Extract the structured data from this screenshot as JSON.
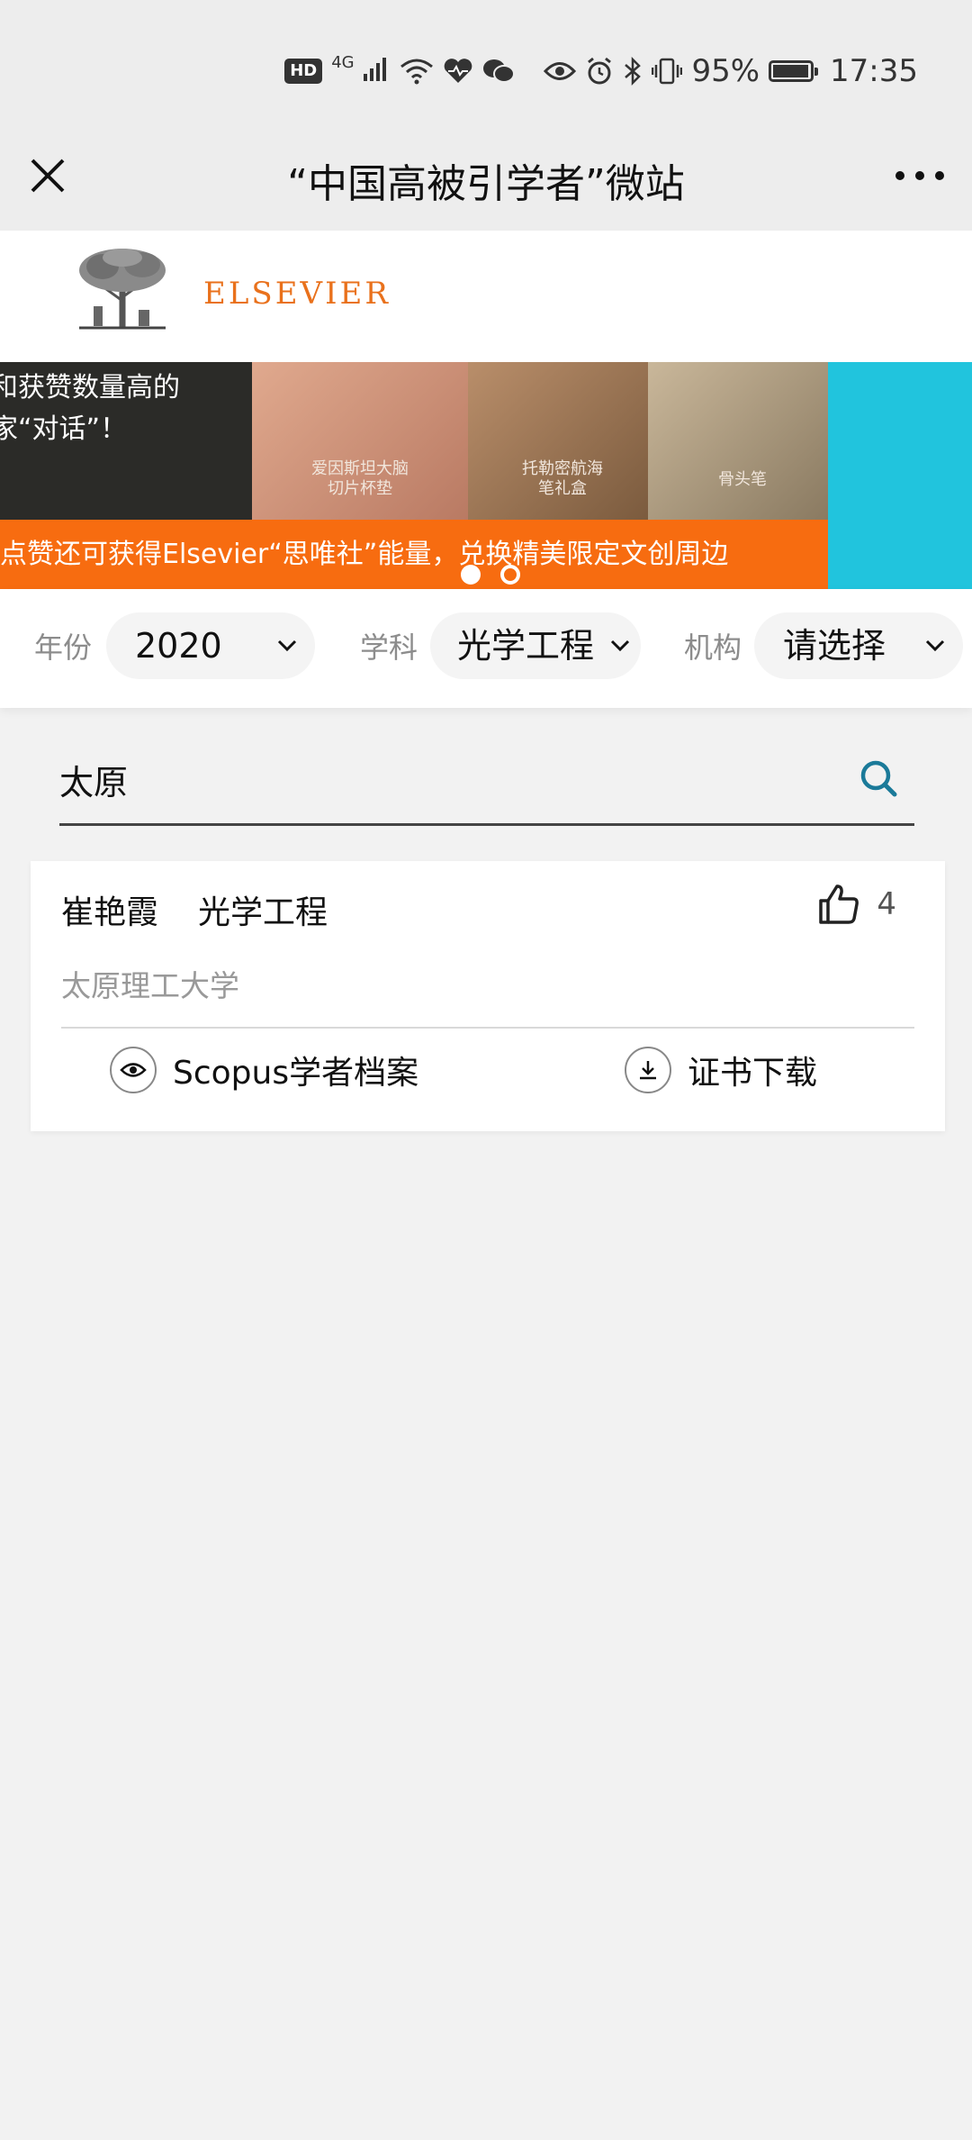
{
  "status_bar": {
    "hd": "HD",
    "network": "4G",
    "battery_percent": "95%",
    "time": "17:35"
  },
  "nav": {
    "title": "“中国高被引学者”微站",
    "close_icon": "close-icon",
    "more_icon": "more-icon"
  },
  "brand": {
    "name": "ELSEVIER",
    "color": "#e9711c"
  },
  "banner": {
    "headline_line1": "和获赞数量高的",
    "headline_line2": "家“对话”！",
    "caption_1_line1": "爱因斯坦大脑",
    "caption_1_line2": "切片杯垫",
    "caption_2_line1": "托勒密航海",
    "caption_2_line2": "笔礼盒",
    "caption_3": "骨头笔",
    "strip_text": "点赞还可获得Elsevier“思唯社”能量，兑换精美限定文创周边",
    "strip_color": "#f76c10",
    "active_dot": 1,
    "dot_count": 2
  },
  "filters": {
    "year_label": "年份",
    "year_value": "2020",
    "subject_label": "学科",
    "subject_value": "光学工程",
    "institution_label": "机构",
    "institution_value": "请选择"
  },
  "search": {
    "value": "太原",
    "icon": "search-icon",
    "icon_color": "#1b7a99"
  },
  "results": [
    {
      "name": "崔艳霞",
      "field": "光学工程",
      "likes": "4",
      "institution": "太原理工大学",
      "scopus_label": "Scopus学者档案",
      "certificate_label": "证书下载"
    }
  ]
}
